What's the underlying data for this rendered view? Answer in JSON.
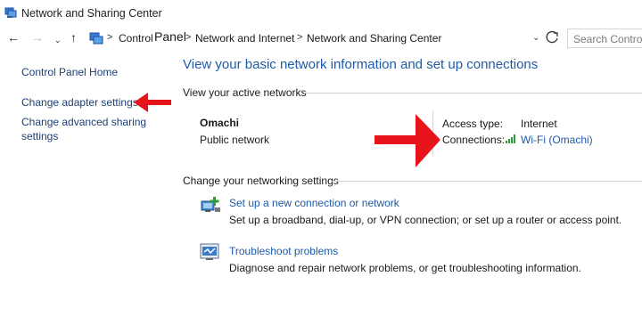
{
  "window": {
    "title": "Network and Sharing Center"
  },
  "address": {
    "crumbs": [
      "Control",
      "Panel",
      "Network and Internet",
      "Network and Sharing Center"
    ],
    "search_placeholder": "Search Control"
  },
  "sidebar": {
    "items": [
      {
        "label": "Control Panel Home"
      },
      {
        "label": "Change adapter settings"
      },
      {
        "label": "Change advanced sharing"
      },
      {
        "label": "settings"
      }
    ]
  },
  "main": {
    "heading": "View your basic network information and set up connections",
    "active_section": "View your active networks",
    "network": {
      "name": "Omachi",
      "type": "Public network",
      "access_label": "Access type:",
      "access_value": "Internet",
      "connections_label": "Connections:",
      "connection_value": "Wi-Fi (Omachi)"
    },
    "settings_section": "Change your networking settings",
    "tasks": [
      {
        "title": "Set up a new connection or network",
        "desc": "Set up a broadband, dial-up, or VPN connection; or set up a router or access point."
      },
      {
        "title": "Troubleshoot problems",
        "desc": "Diagnose and repair network problems, or get troubleshooting information."
      }
    ]
  },
  "colors": {
    "accent": "#1e5aa8",
    "annotation": "#e8141c"
  },
  "icons": [
    "control-panel-icon",
    "back-arrow-icon",
    "forward-arrow-icon",
    "recent-dropdown-icon",
    "up-arrow-icon",
    "refresh-icon",
    "wifi-signal-icon",
    "new-connection-icon",
    "troubleshoot-icon"
  ]
}
